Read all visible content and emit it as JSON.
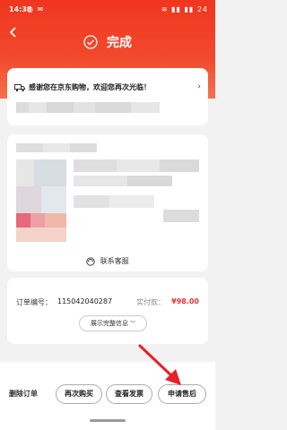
{
  "status_bar": {
    "time": "14:38",
    "left_icons": "◷ ✉",
    "right_icons": "≋ ▮▮ ▮▮ 24"
  },
  "header": {
    "title": "完成"
  },
  "greeting": {
    "text": "感谢您在京东购物，欢迎您再次光临！"
  },
  "customer_service": {
    "label": "联系客服"
  },
  "order": {
    "number_label": "订单编号：",
    "number": "115042040287",
    "paid_label": "实付款：",
    "paid_value": "¥98.00",
    "show_all_label": "展示完整信息"
  },
  "actions": {
    "delete": "删除订单",
    "rebuy": "再次购买",
    "invoice": "查看发票",
    "aftersale": "申请售后"
  },
  "colors": {
    "brand_red": "#f0361f",
    "price_red": "#e33333",
    "annotation_arrow": "#e8202a"
  }
}
